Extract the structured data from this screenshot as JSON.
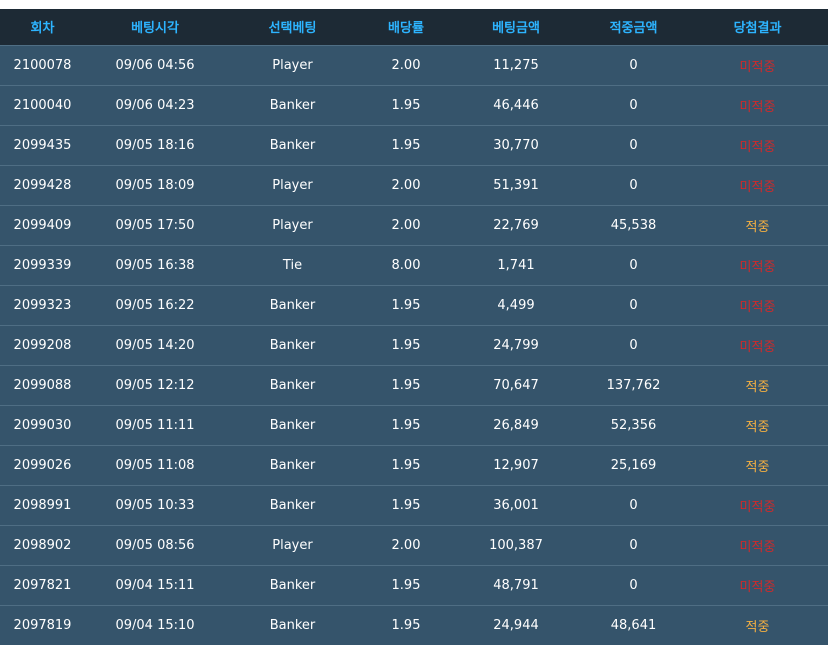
{
  "colors": {
    "header_bg": "#1d2a35",
    "header_text": "#2db4ff",
    "row_bg": "#35546b",
    "row_border": "#4f6e84",
    "lose": "#d02a2a",
    "win": "#f5b041"
  },
  "table": {
    "headers": [
      "회차",
      "베팅시각",
      "선택베팅",
      "배당률",
      "베팅금액",
      "적중금액",
      "당첨결과"
    ],
    "rows": [
      {
        "round": "2100078",
        "time": "09/06 04:56",
        "pick": "Player",
        "odds": "2.00",
        "bet": "11,275",
        "win_amount": "0",
        "result": "미적중",
        "status": "lose"
      },
      {
        "round": "2100040",
        "time": "09/06 04:23",
        "pick": "Banker",
        "odds": "1.95",
        "bet": "46,446",
        "win_amount": "0",
        "result": "미적중",
        "status": "lose"
      },
      {
        "round": "2099435",
        "time": "09/05 18:16",
        "pick": "Banker",
        "odds": "1.95",
        "bet": "30,770",
        "win_amount": "0",
        "result": "미적중",
        "status": "lose"
      },
      {
        "round": "2099428",
        "time": "09/05 18:09",
        "pick": "Player",
        "odds": "2.00",
        "bet": "51,391",
        "win_amount": "0",
        "result": "미적중",
        "status": "lose"
      },
      {
        "round": "2099409",
        "time": "09/05 17:50",
        "pick": "Player",
        "odds": "2.00",
        "bet": "22,769",
        "win_amount": "45,538",
        "result": "적중",
        "status": "win"
      },
      {
        "round": "2099339",
        "time": "09/05 16:38",
        "pick": "Tie",
        "odds": "8.00",
        "bet": "1,741",
        "win_amount": "0",
        "result": "미적중",
        "status": "lose"
      },
      {
        "round": "2099323",
        "time": "09/05 16:22",
        "pick": "Banker",
        "odds": "1.95",
        "bet": "4,499",
        "win_amount": "0",
        "result": "미적중",
        "status": "lose"
      },
      {
        "round": "2099208",
        "time": "09/05 14:20",
        "pick": "Banker",
        "odds": "1.95",
        "bet": "24,799",
        "win_amount": "0",
        "result": "미적중",
        "status": "lose"
      },
      {
        "round": "2099088",
        "time": "09/05 12:12",
        "pick": "Banker",
        "odds": "1.95",
        "bet": "70,647",
        "win_amount": "137,762",
        "result": "적중",
        "status": "win"
      },
      {
        "round": "2099030",
        "time": "09/05 11:11",
        "pick": "Banker",
        "odds": "1.95",
        "bet": "26,849",
        "win_amount": "52,356",
        "result": "적중",
        "status": "win"
      },
      {
        "round": "2099026",
        "time": "09/05 11:08",
        "pick": "Banker",
        "odds": "1.95",
        "bet": "12,907",
        "win_amount": "25,169",
        "result": "적중",
        "status": "win"
      },
      {
        "round": "2098991",
        "time": "09/05 10:33",
        "pick": "Banker",
        "odds": "1.95",
        "bet": "36,001",
        "win_amount": "0",
        "result": "미적중",
        "status": "lose"
      },
      {
        "round": "2098902",
        "time": "09/05 08:56",
        "pick": "Player",
        "odds": "2.00",
        "bet": "100,387",
        "win_amount": "0",
        "result": "미적중",
        "status": "lose"
      },
      {
        "round": "2097821",
        "time": "09/04 15:11",
        "pick": "Banker",
        "odds": "1.95",
        "bet": "48,791",
        "win_amount": "0",
        "result": "미적중",
        "status": "lose"
      },
      {
        "round": "2097819",
        "time": "09/04 15:10",
        "pick": "Banker",
        "odds": "1.95",
        "bet": "24,944",
        "win_amount": "48,641",
        "result": "적중",
        "status": "win"
      }
    ]
  }
}
